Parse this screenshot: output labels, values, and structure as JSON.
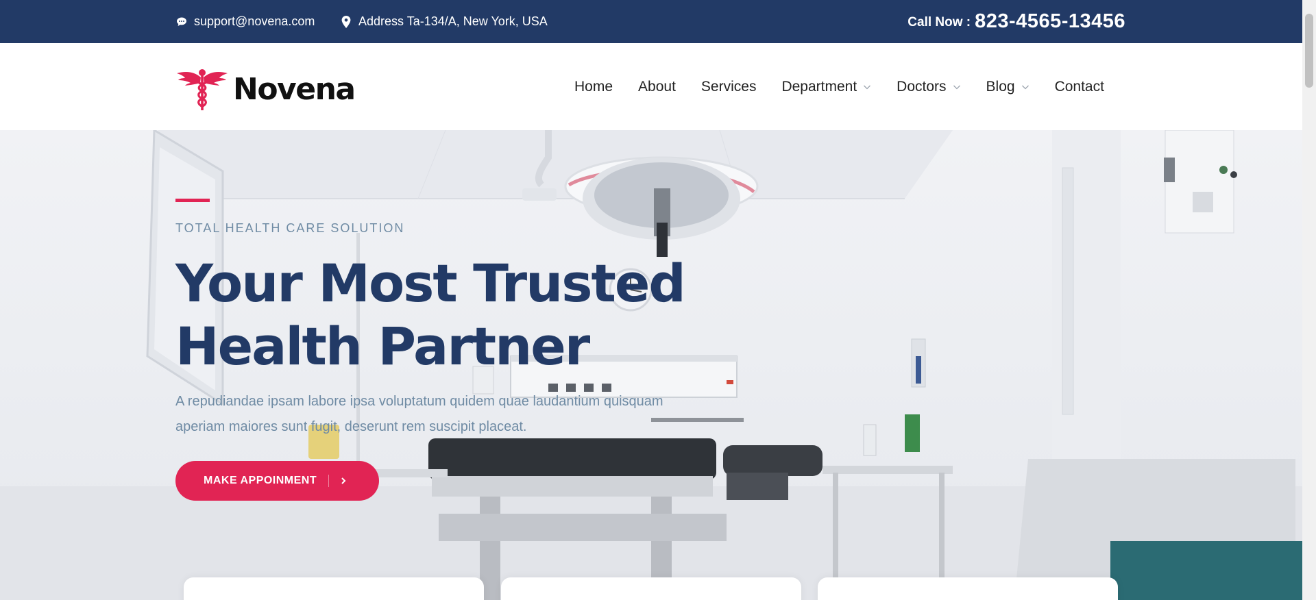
{
  "topbar": {
    "email": "support@novena.com",
    "address": "Address Ta-134/A, New York, USA",
    "call_label": "Call Now :",
    "call_number": "823-4565-13456",
    "email_icon": "chat-bubble-icon",
    "address_icon": "map-pin-icon"
  },
  "brand": {
    "name": "Novena",
    "logo_icon": "caduceus-icon",
    "logo_color": "#e12454"
  },
  "nav": {
    "items": [
      {
        "label": "Home",
        "has_dropdown": false
      },
      {
        "label": "About",
        "has_dropdown": false
      },
      {
        "label": "Services",
        "has_dropdown": false
      },
      {
        "label": "Department",
        "has_dropdown": true
      },
      {
        "label": "Doctors",
        "has_dropdown": true
      },
      {
        "label": "Blog",
        "has_dropdown": true
      },
      {
        "label": "Contact",
        "has_dropdown": false
      }
    ]
  },
  "hero": {
    "eyebrow": "TOTAL HEALTH CARE SOLUTION",
    "title_line1": "Your Most Trusted",
    "title_line2": "Health Partner",
    "description": "A repudiandae ipsam labore ipsa voluptatum quidem quae laudantium quisquam aperiam maiores sunt fugit, deserunt rem suscipit placeat.",
    "button_label": "MAKE APPOINMENT",
    "button_icon": "chevron-right-icon"
  },
  "colors": {
    "primary": "#223a66",
    "accent": "#e12454",
    "muted_text": "#6f8ba4"
  }
}
